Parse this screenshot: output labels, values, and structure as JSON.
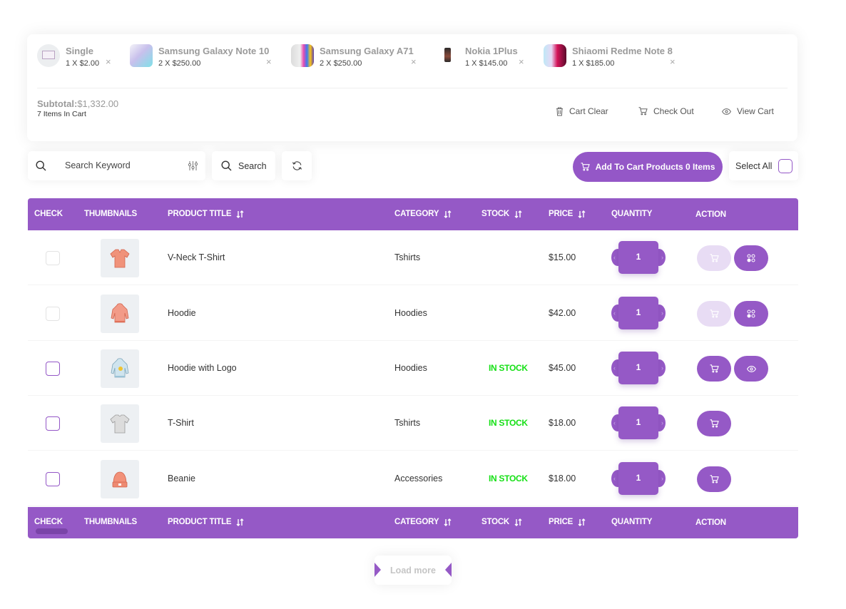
{
  "mini_cart": {
    "items": [
      {
        "name": "Single",
        "qty_price": "1 X $2.00",
        "thumb": "product-thumb-single"
      },
      {
        "name": "Samsung Galaxy Note 10",
        "qty_price": "2 X $250.00",
        "thumb": "phone-thumb"
      },
      {
        "name": "Samsung Galaxy A71",
        "qty_price": "2 X $250.00",
        "thumb": "phone-thumb"
      },
      {
        "name": "Nokia 1Plus",
        "qty_price": "1 X $145.00",
        "thumb": "phone-thumb"
      },
      {
        "name": "Shiaomi Redme Note 8",
        "qty_price": "1 X $185.00",
        "thumb": "phone-thumb"
      }
    ],
    "remove_glyph": "×",
    "subtotal_label": "Subtotal:",
    "subtotal_value": "$1,332.00",
    "items_count": "7 Items In Cart",
    "actions": {
      "clear": "Cart Clear",
      "checkout": "Check Out",
      "view": "View Cart"
    }
  },
  "toolbar": {
    "search_placeholder": "Search Keyword",
    "search_value": "",
    "search_button": "Search",
    "add_to_cart_bulk": "Add To Cart Products 0 Items",
    "select_all": "Select All"
  },
  "table": {
    "columns": {
      "check": "CHECK",
      "thumbnails": "THUMBNAILS",
      "title": "PRODUCT TITLE",
      "category": "CATEGORY",
      "stock": "STOCK",
      "price": "PRICE",
      "quantity": "QUANTITY",
      "action": "ACTION"
    },
    "rows": [
      {
        "title": "V-Neck T-Shirt",
        "category": "Tshirts",
        "stock": "",
        "price": "$15.00",
        "quantity": "1",
        "thumb": "vneck-tshirt",
        "has_options": true,
        "enabled": false
      },
      {
        "title": "Hoodie",
        "category": "Hoodies",
        "stock": "",
        "price": "$42.00",
        "quantity": "1",
        "thumb": "hoodie",
        "has_options": true,
        "enabled": false
      },
      {
        "title": "Hoodie with Logo",
        "category": "Hoodies",
        "stock": "IN STOCK",
        "price": "$45.00",
        "quantity": "1",
        "thumb": "hoodie-logo",
        "has_view": true,
        "enabled": true
      },
      {
        "title": "T-Shirt",
        "category": "Tshirts",
        "stock": "IN STOCK",
        "price": "$18.00",
        "quantity": "1",
        "thumb": "tshirt",
        "enabled": true
      },
      {
        "title": "Beanie",
        "category": "Accessories",
        "stock": "IN STOCK",
        "price": "$18.00",
        "quantity": "1",
        "thumb": "beanie",
        "enabled": true
      }
    ]
  },
  "load_more": "Load more",
  "colors": {
    "accent": "#9559c6",
    "accent_light": "#e8dcf4",
    "in_stock": "#16e016"
  }
}
